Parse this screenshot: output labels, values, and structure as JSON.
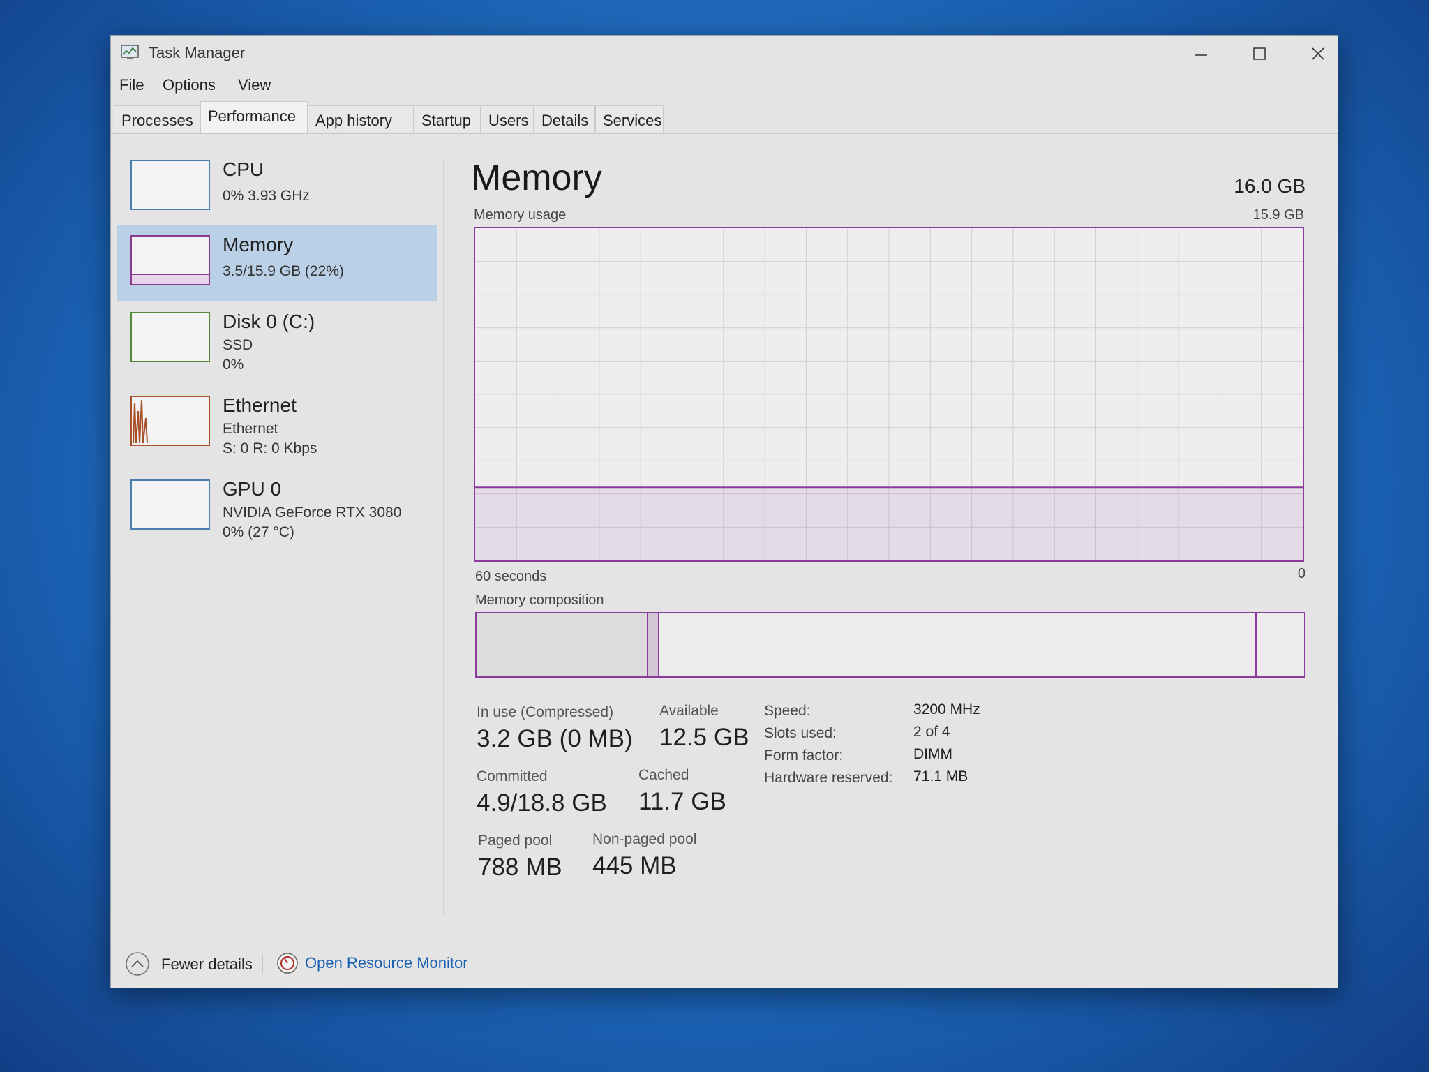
{
  "window": {
    "title": "Task Manager",
    "icon": "task-manager-icon"
  },
  "menu": [
    "File",
    "Options",
    "View"
  ],
  "tabs": [
    {
      "label": "Processes",
      "active": false
    },
    {
      "label": "Performance",
      "active": true
    },
    {
      "label": "App history",
      "active": false
    },
    {
      "label": "Startup",
      "active": false
    },
    {
      "label": "Users",
      "active": false
    },
    {
      "label": "Details",
      "active": false
    },
    {
      "label": "Services",
      "active": false
    }
  ],
  "sidebar": {
    "cpu": {
      "name": "CPU",
      "line1": "0% 3.93 GHz"
    },
    "memory": {
      "name": "Memory",
      "line1": "3.5/15.9 GB (22%)",
      "selected": true
    },
    "disk": {
      "name": "Disk 0 (C:)",
      "line1": "SSD",
      "line2": "0%"
    },
    "ethernet": {
      "name": "Ethernet",
      "line1": "Ethernet",
      "line2": "S: 0 R: 0 Kbps"
    },
    "gpu": {
      "name": "GPU 0",
      "line1": "NVIDIA GeForce RTX 3080",
      "line2": "0% (27 °C)"
    }
  },
  "memory": {
    "title": "Memory",
    "total": "16.0 GB",
    "usage_label": "Memory usage",
    "usage_max": "15.9 GB",
    "time_left": "60 seconds",
    "time_right": "0",
    "composition_label": "Memory composition",
    "usage_fraction": 0.22,
    "stats": {
      "in_use_label": "In use (Compressed)",
      "in_use_value": "3.2 GB (0 MB)",
      "available_label": "Available",
      "available_value": "12.5 GB",
      "committed_label": "Committed",
      "committed_value": "4.9/18.8 GB",
      "cached_label": "Cached",
      "cached_value": "11.7 GB",
      "paged_label": "Paged pool",
      "paged_value": "788 MB",
      "nonpaged_label": "Non-paged pool",
      "nonpaged_value": "445 MB"
    },
    "specs": {
      "speed_label": "Speed:",
      "speed_value": "3200 MHz",
      "slots_label": "Slots used:",
      "slots_value": "2 of 4",
      "form_label": "Form factor:",
      "form_value": "DIMM",
      "hwres_label": "Hardware reserved:",
      "hwres_value": "71.1 MB"
    }
  },
  "footer": {
    "fewer_details": "Fewer details",
    "resource_monitor": "Open Resource Monitor"
  },
  "colors": {
    "memory_accent": "#8b3a9e",
    "link": "#1a5fb4",
    "selected_bg": "#b9d0e6"
  }
}
